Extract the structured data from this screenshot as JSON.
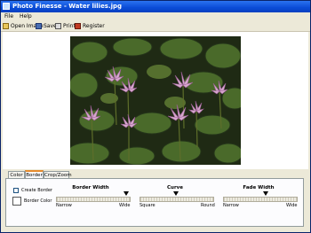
{
  "window": {
    "title": "Photo Finesse - Water lilies.jpg"
  },
  "menu": {
    "items": [
      "File",
      "Help"
    ]
  },
  "toolbar": {
    "open_label": "Open Image",
    "save_label": "Save",
    "print_label": "Print",
    "register_label": "Register"
  },
  "tabs": [
    {
      "label": "Color",
      "active": false
    },
    {
      "label": "Border",
      "active": true
    },
    {
      "label": "Crop/Zoom",
      "active": false
    }
  ],
  "border": {
    "create_border_label": "Create Border",
    "create_border_checked": false,
    "border_color_label": "Border Color",
    "border_color": "#ffffff"
  },
  "sliders": [
    {
      "title": "Border Width",
      "min_label": "Narrow",
      "max_label": "Wide",
      "value_fraction": 0.95
    },
    {
      "title": "Curve",
      "min_label": "Square",
      "max_label": "Round",
      "value_fraction": 0.5
    },
    {
      "title": "Fade Width",
      "min_label": "Narrow",
      "max_label": "Wide",
      "value_fraction": 0.55
    }
  ]
}
